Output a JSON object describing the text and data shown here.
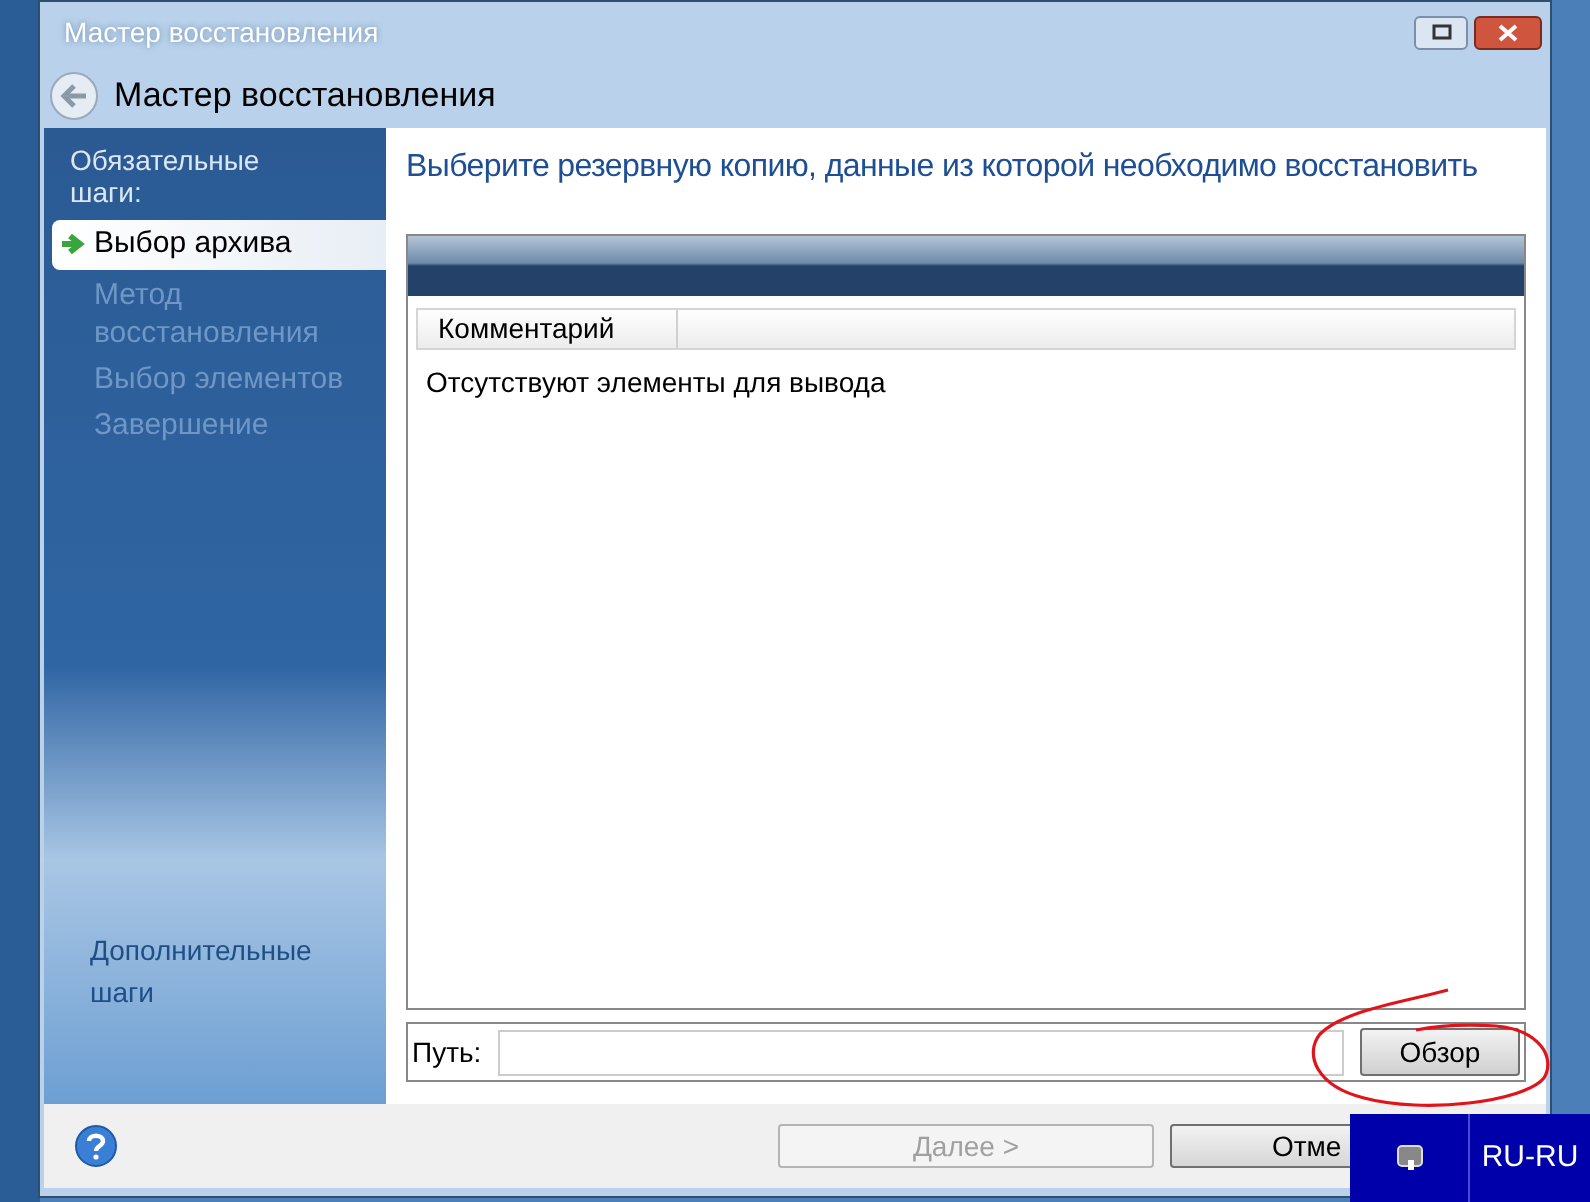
{
  "window": {
    "title": "Мастер восстановления"
  },
  "header": {
    "title": "Мастер восстановления"
  },
  "sidebar": {
    "required_heading": "Обязательные шаги:",
    "steps": [
      {
        "label": "Выбор архива",
        "selected": true
      },
      {
        "label": "Метод восстановления",
        "selected": false
      },
      {
        "label": "Выбор элементов",
        "selected": false
      },
      {
        "label": "Завершение",
        "selected": false
      }
    ],
    "optional_heading": "Дополнительные шаги"
  },
  "content": {
    "heading": "Выберите резервную копию, данные из которой необходимо восстановить",
    "table": {
      "columns": [
        "Комментарий"
      ],
      "empty_message": "Отсутствуют элементы для вывода"
    },
    "path": {
      "label": "Путь:"
    },
    "browse_button": "Обзор"
  },
  "footer": {
    "buttons": [
      {
        "label": "Далее >",
        "disabled": true
      },
      {
        "label": "Отме",
        "disabled": false
      }
    ]
  },
  "taskbar": {
    "language": "RU-RU"
  }
}
